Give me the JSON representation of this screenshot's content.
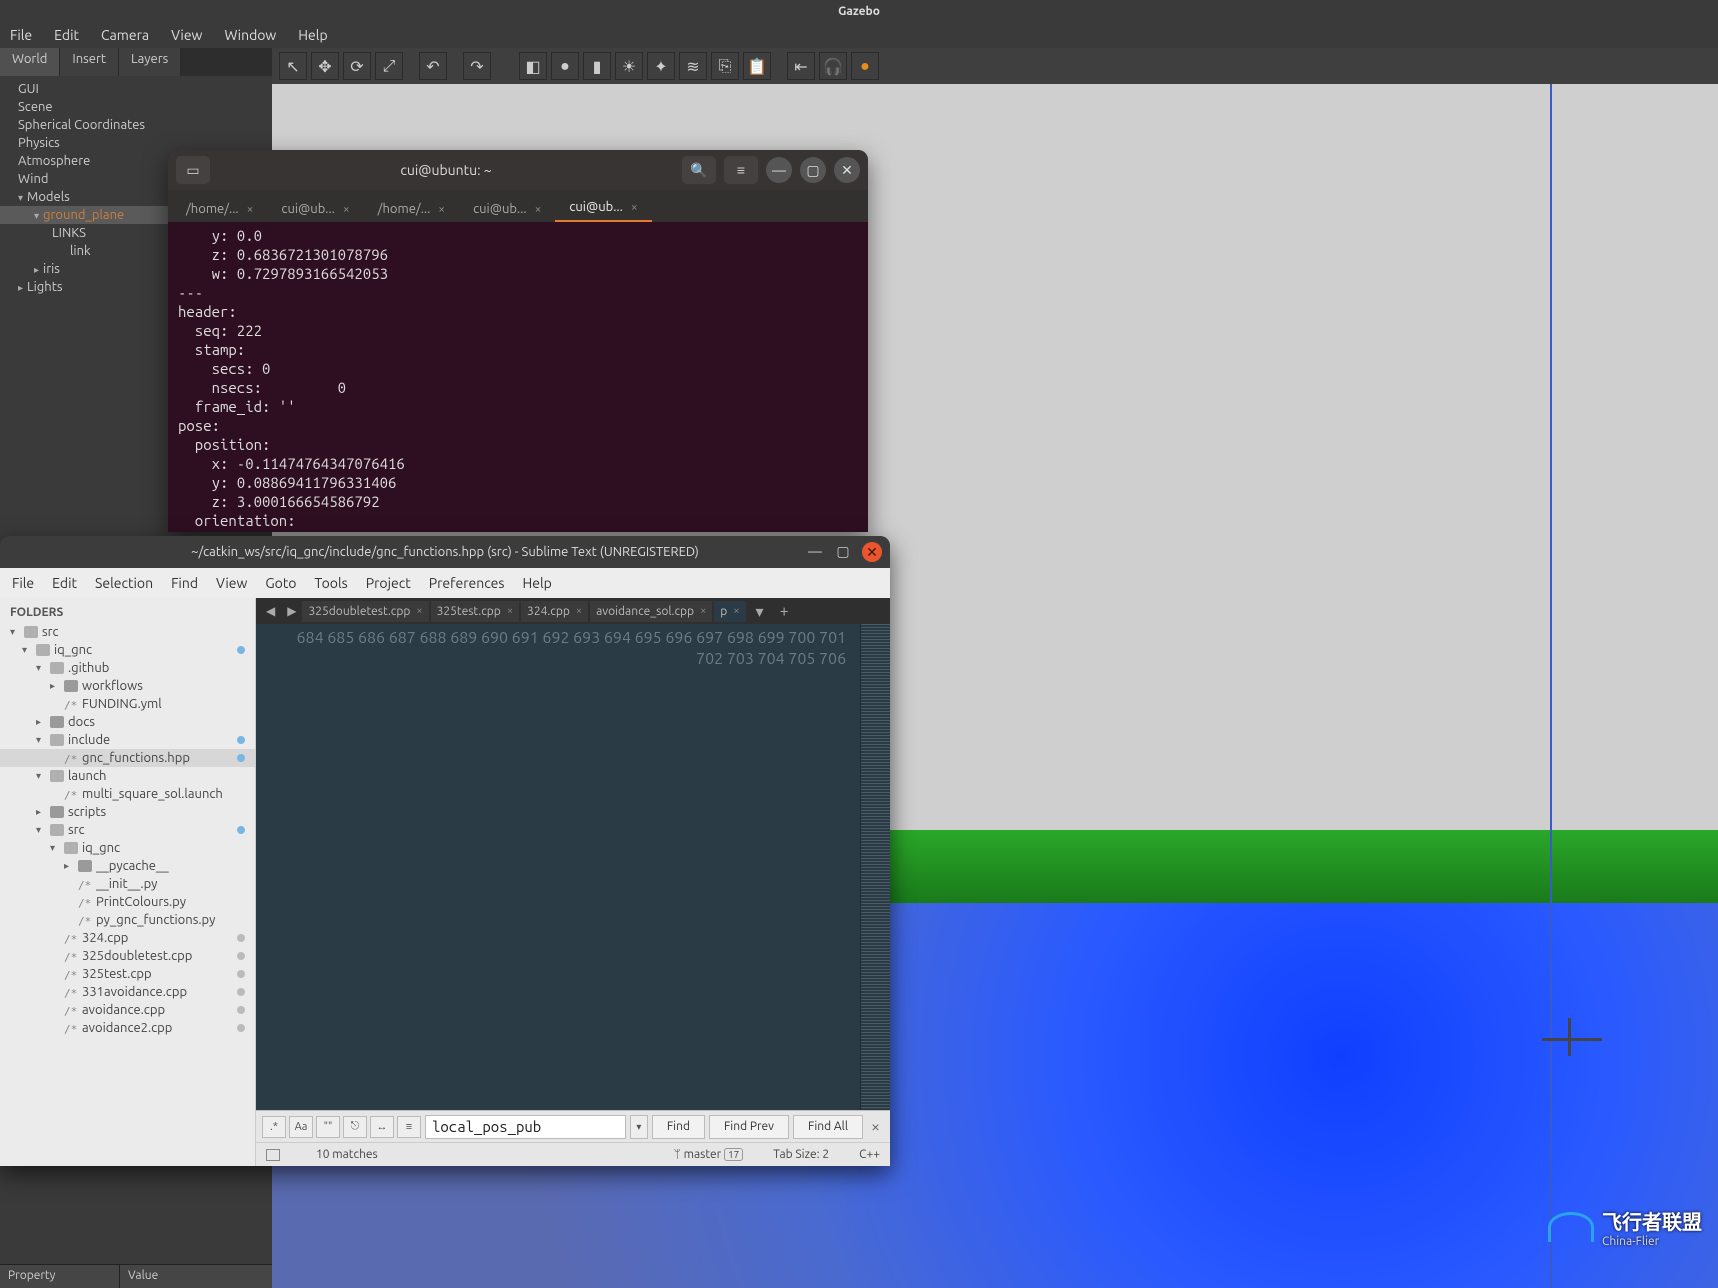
{
  "gazebo": {
    "title": "Gazebo",
    "menu": [
      "File",
      "Edit",
      "Camera",
      "View",
      "Window",
      "Help"
    ],
    "sidebarTabs": [
      "World",
      "Insert",
      "Layers"
    ],
    "tree": [
      {
        "t": "GUI",
        "l": 1
      },
      {
        "t": "Scene",
        "l": 1
      },
      {
        "t": "Spherical Coordinates",
        "l": 1
      },
      {
        "t": "Physics",
        "l": 1
      },
      {
        "t": "Atmosphere",
        "l": 1
      },
      {
        "t": "Wind",
        "l": 1
      },
      {
        "t": "Models",
        "l": 1,
        "caret": "d"
      },
      {
        "t": "ground_plane",
        "l": 2,
        "caret": "d",
        "sel": true
      },
      {
        "t": "LINKS",
        "l": 3
      },
      {
        "t": "link",
        "l": 4
      },
      {
        "t": "iris",
        "l": 2,
        "caret": "r"
      },
      {
        "t": "Lights",
        "l": 1,
        "caret": "r"
      }
    ],
    "propHeader": {
      "k": "Property",
      "v": "Value"
    },
    "toolbarIcons": [
      "cursor",
      "move",
      "rotate",
      "scale",
      "sep",
      "undo",
      "sep",
      "redo",
      "sep",
      "sep",
      "box",
      "sphere",
      "cyl",
      "light1",
      "light2",
      "light3",
      "copy",
      "paste",
      "sep",
      "align",
      "snap",
      "record"
    ]
  },
  "terminal": {
    "title": "cui@ubuntu: ~",
    "tabs": [
      {
        "label": "/home/..."
      },
      {
        "label": "cui@ub..."
      },
      {
        "label": "/home/..."
      },
      {
        "label": "cui@ub..."
      },
      {
        "label": "cui@ub...",
        "active": true
      }
    ],
    "body": "    y: 0.0\n    z: 0.6836721301078796\n    w: 0.7297893166542053\n---\nheader:\n  seq: 222\n  stamp:\n    secs: 0\n    nsecs:         0\n  frame_id: ''\npose:\n  position:\n    x: -0.11474764347076416\n    y: 0.08869411796331406\n    z: 3.000166654586792\n  orientation:"
  },
  "sublime": {
    "title": "~/catkin_ws/src/iq_gnc/include/gnc_functions.hpp (src) - Sublime Text (UNREGISTERED)",
    "menu": [
      "File",
      "Edit",
      "Selection",
      "Find",
      "View",
      "Goto",
      "Tools",
      "Project",
      "Preferences",
      "Help"
    ],
    "sidebarHeader": "FOLDERS",
    "tree": [
      {
        "caret": "▾",
        "ic": "folder open",
        "nm": "src",
        "ind": 0
      },
      {
        "caret": "▾",
        "ic": "folder open",
        "nm": "iq_gnc",
        "ind": 1,
        "dot": true
      },
      {
        "caret": "▾",
        "ic": "folder open",
        "nm": ".github",
        "ind": 2
      },
      {
        "caret": "▸",
        "ic": "folder",
        "nm": "workflows",
        "ind": 3
      },
      {
        "caret": "",
        "ic": "file",
        "nm": "FUNDING.yml",
        "ind": 3
      },
      {
        "caret": "▸",
        "ic": "folder",
        "nm": "docs",
        "ind": 2
      },
      {
        "caret": "▾",
        "ic": "folder open",
        "nm": "include",
        "ind": 2,
        "dot": true
      },
      {
        "caret": "",
        "ic": "file",
        "nm": "gnc_functions.hpp",
        "ind": 3,
        "dot": true,
        "sel": true
      },
      {
        "caret": "▾",
        "ic": "folder open",
        "nm": "launch",
        "ind": 2
      },
      {
        "caret": "",
        "ic": "file",
        "nm": "multi_square_sol.launch",
        "ind": 3
      },
      {
        "caret": "▸",
        "ic": "folder",
        "nm": "scripts",
        "ind": 2
      },
      {
        "caret": "▾",
        "ic": "folder open",
        "nm": "src",
        "ind": 2,
        "dot": true
      },
      {
        "caret": "▾",
        "ic": "folder open",
        "nm": "iq_gnc",
        "ind": 3
      },
      {
        "caret": "▸",
        "ic": "folder",
        "nm": "__pycache__",
        "ind": 4
      },
      {
        "caret": "",
        "ic": "file",
        "nm": "__init__.py",
        "ind": 4
      },
      {
        "caret": "",
        "ic": "file",
        "nm": "PrintColours.py",
        "ind": 4
      },
      {
        "caret": "",
        "ic": "file",
        "nm": "py_gnc_functions.py",
        "ind": 4
      },
      {
        "caret": "",
        "ic": "file",
        "nm": "324.cpp",
        "ind": 3,
        "dotg": true
      },
      {
        "caret": "",
        "ic": "file",
        "nm": "325doubletest.cpp",
        "ind": 3,
        "dotg": true
      },
      {
        "caret": "",
        "ic": "file",
        "nm": "325test.cpp",
        "ind": 3,
        "dotg": true
      },
      {
        "caret": "",
        "ic": "file",
        "nm": "331avoidance.cpp",
        "ind": 3,
        "dotg": true
      },
      {
        "caret": "",
        "ic": "file",
        "nm": "avoidance.cpp",
        "ind": 3,
        "dotg": true
      },
      {
        "caret": "",
        "ic": "file",
        "nm": "avoidance2.cpp",
        "ind": 3,
        "dotg": true
      }
    ],
    "tabs": [
      {
        "label": "325doubletest.cpp"
      },
      {
        "label": "325test.cpp"
      },
      {
        "label": "324.cpp"
      },
      {
        "label": "avoidance_sol.cpp"
      },
      {
        "label": "p",
        "active": true
      }
    ],
    "firstLine": 684,
    "findOpts": [
      ".*",
      "Aa",
      "\"\"",
      "⎋",
      "↔",
      "≡"
    ],
    "findValue": "local_pos_pub",
    "findButtons": [
      "Find",
      "Find Prev",
      "Find All"
    ],
    "status": {
      "matches": "10 matches",
      "branch": "master",
      "branchCount": "17",
      "tabsize": "Tab Size: 2",
      "lang": "C++"
    }
  },
  "watermark": {
    "main": "飞行者联盟",
    "sub": "China-Flier"
  }
}
